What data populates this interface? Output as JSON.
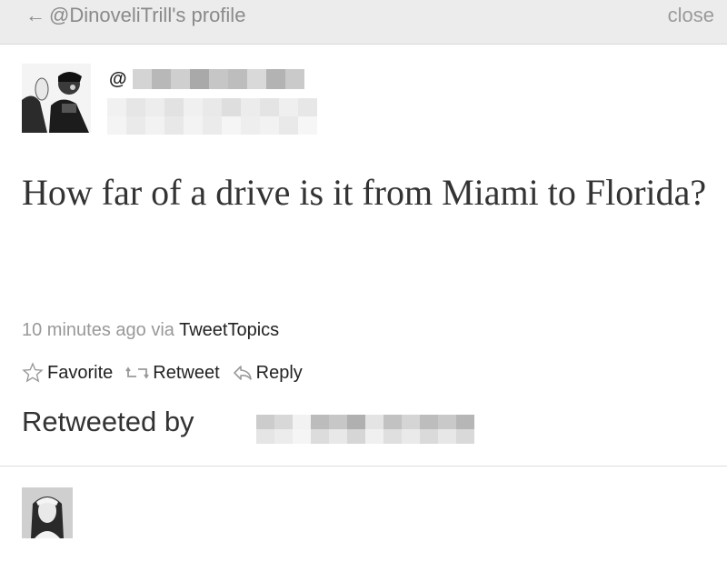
{
  "header": {
    "back_label": "@DinoveliTrill's profile",
    "back_icon": "arrow-left-icon",
    "close_label": "close"
  },
  "tweet": {
    "handle_prefix": "@",
    "text": "How far of a drive is it from Miami to Florida?",
    "time": "10 minutes ago",
    "via_label": "via",
    "source": "TweetTopics"
  },
  "actions": {
    "favorite_label": "Favorite",
    "favorite_icon": "star-icon",
    "retweet_label": "Retweet",
    "retweet_icon": "retweet-icon",
    "reply_label": "Reply",
    "reply_icon": "reply-icon"
  },
  "retweeted": {
    "label": "Retweeted by"
  },
  "colors": {
    "topbar": "#ececec",
    "muted_text": "#999999",
    "body_text": "#333333"
  }
}
